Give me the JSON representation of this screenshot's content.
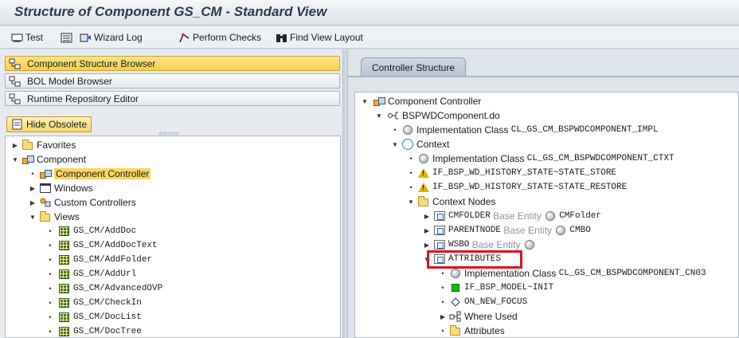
{
  "window": {
    "title": "Structure of Component GS_CM - Standard View"
  },
  "toolbar": {
    "test": "Test",
    "wizard_log": "Wizard Log",
    "perform_checks": "Perform Checks",
    "find_view_layout": "Find View Layout"
  },
  "left": {
    "buttons": {
      "component_structure_browser": "Component Structure Browser",
      "bol_model_browser": "BOL Model Browser",
      "runtime_repository_editor": "Runtime Repository Editor",
      "hide_obsolete": "Hide Obsolete"
    },
    "tree": {
      "favorites": "Favorites",
      "component": "Component",
      "component_controller": "Component Controller",
      "windows": "Windows",
      "custom_controllers": "Custom Controllers",
      "views": "Views",
      "view_items": [
        "GS_CM/AddDoc",
        "GS_CM/AddDocText",
        "GS_CM/AddFolder",
        "GS_CM/AddUrl",
        "GS_CM/AdvancedOVP",
        "GS_CM/CheckIn",
        "GS_CM/DocList",
        "GS_CM/DocTree"
      ]
    }
  },
  "right": {
    "tab": "Controller Structure",
    "tree": {
      "component_controller": "Component Controller",
      "bspwd": "BSPWDComponent.do",
      "impl_label": "Implementation Class",
      "impl_value": "CL_GS_CM_BSPWDCOMPONENT_IMPL",
      "context": "Context",
      "ctx_impl_label": "Implementation Class",
      "ctx_impl_value": "CL_GS_CM_BSPWDCOMPONENT_CTXT",
      "history_store": "IF_BSP_WD_HISTORY_STATE~STATE_STORE",
      "history_restore": "IF_BSP_WD_HISTORY_STATE~STATE_RESTORE",
      "context_nodes": "Context Nodes",
      "base_entity": "Base Entity",
      "cmfolder": "CMFOLDER",
      "cmfolder_entity": "CMFolder",
      "parentnode": "PARENTNODE",
      "parentnode_entity": "CMBO",
      "wsbo": "WSBO",
      "attributes_node": "ATTRIBUTES",
      "attr_impl_label": "Implementation Class",
      "attr_impl_value": "CL_GS_CM_BSPWDCOMPONENT_CN03",
      "model_init": "IF_BSP_MODEL~INIT",
      "on_new_focus": "ON_NEW_FOCUS",
      "where_used": "Where Used",
      "attributes": "Attributes"
    }
  },
  "colors": {
    "highlight": "#e0131c",
    "selected": "#f8d860",
    "button": "#f7cf4a"
  }
}
